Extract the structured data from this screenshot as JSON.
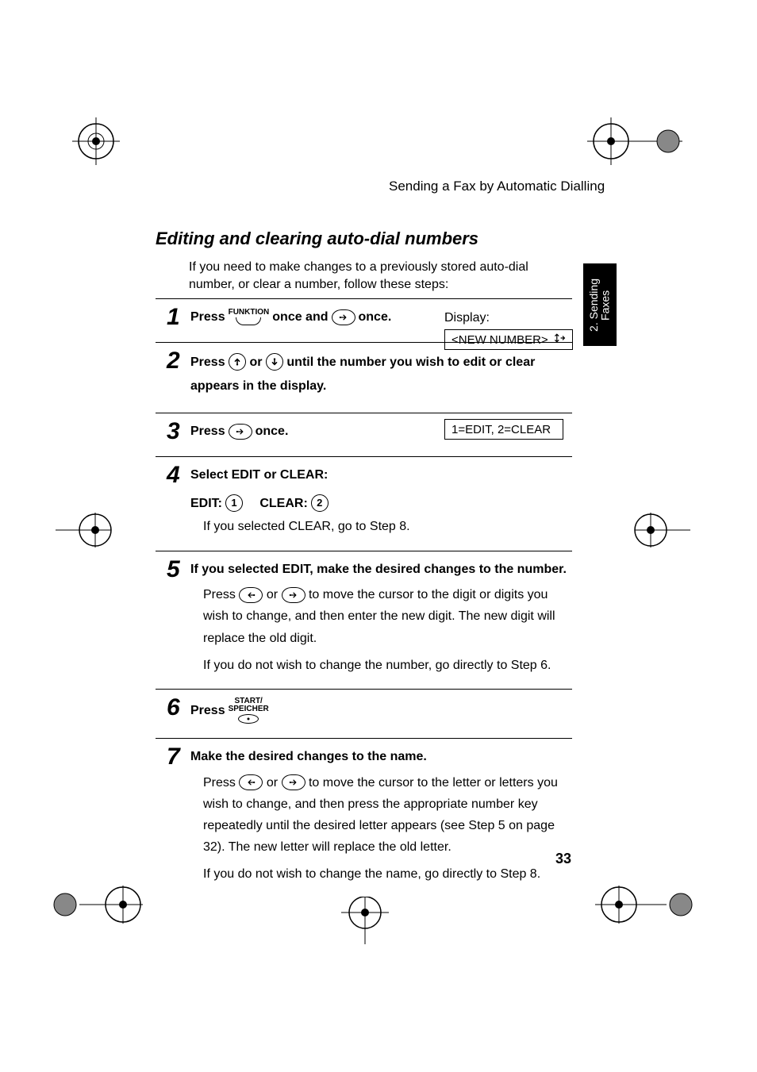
{
  "header": "Sending a Fax by Automatic Dialling",
  "section_title": "Editing and clearing auto-dial numbers",
  "intro": "If you need to make changes to a previously stored auto-dial number, or clear a number, follow these steps:",
  "side_tab": "2. Sending\nFaxes",
  "display_label": "Display:",
  "display1": "<NEW NUMBER>",
  "display2": "1=EDIT, 2=CLEAR",
  "key_funktion": "FUNKTION",
  "key_start_line1": "START/",
  "key_start_line2": "SPEICHER",
  "digit_1": "1",
  "digit_2": "2",
  "steps": {
    "s1": {
      "press": "Press",
      "once_and": "once and",
      "once": "once."
    },
    "s2": {
      "press": "Press",
      "or": "or",
      "tail": "until the number you wish to edit or clear appears in the display."
    },
    "s3": {
      "press": "Press",
      "once": "once."
    },
    "s4": {
      "head": "Select EDIT or CLEAR:",
      "edit": "EDIT:",
      "clear": "CLEAR:",
      "note": "If you selected CLEAR, go to Step 8."
    },
    "s5": {
      "head": "If you selected EDIT, make the desired changes to the number.",
      "body1a": "Press",
      "body1b": "or",
      "body1c": "to move the cursor to the digit or digits you wish to change, and then enter the new digit. The new digit will replace the old digit.",
      "body2": "If you do not wish to change the number, go directly to Step 6."
    },
    "s6": {
      "press": "Press"
    },
    "s7": {
      "head": "Make the desired changes to the name.",
      "body1a": "Press",
      "body1b": "or",
      "body1c": "to move the cursor to the letter or letters you wish to change, and then press the appropriate number key repeatedly until the desired letter appears (see Step 5 on page 32). The new letter will replace the old letter.",
      "body2": "If you do not wish to change the name, go directly to Step 8."
    }
  },
  "page_number": "33"
}
